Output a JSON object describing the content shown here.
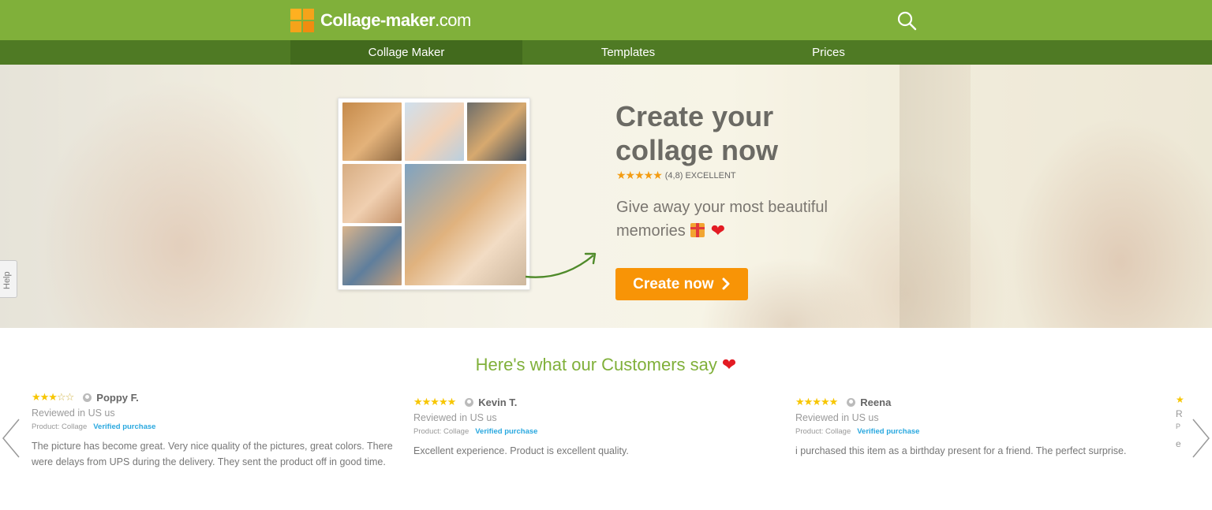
{
  "header": {
    "logo_name": "Collage-maker",
    "logo_tld": ".com",
    "search_icon": "search-icon",
    "brand_color": "#80b03a"
  },
  "nav": {
    "items": [
      {
        "label": "Collage Maker",
        "active": true
      },
      {
        "label": "Templates",
        "active": false
      },
      {
        "label": "Prices",
        "active": false
      }
    ]
  },
  "hero": {
    "title": "Create your collage now",
    "rating_stars": "★★★★★",
    "rating_text": "(4,8) EXCELLENT",
    "subtitle": "Give away your most beautiful memories",
    "cta_label": "Create now",
    "cta_icon": "chevron-right-icon",
    "cta_color": "#f89406"
  },
  "help": {
    "label": "Help"
  },
  "reviews": {
    "title": "Here's what our Customers say",
    "items": [
      {
        "stars_filled": "★★★",
        "stars_empty": "☆☆",
        "name": "Poppy F.",
        "location": "Reviewed in US us",
        "product": "Product: Collage",
        "verified": "Verified purchase",
        "text": "The picture has become great. Very nice quality of the pictures, great colors. There were delays from UPS during the delivery. They sent the product off in good time."
      },
      {
        "stars_filled": "★★★★★",
        "stars_empty": "",
        "name": "Kevin T.",
        "location": "Reviewed in US us",
        "product": "Product: Collage",
        "verified": "Verified purchase",
        "text": "Excellent experience. Product is excellent quality."
      },
      {
        "stars_filled": "★★★★★",
        "stars_empty": "",
        "name": "Reena",
        "location": "Reviewed in US us",
        "product": "Product: Collage",
        "verified": "Verified purchase",
        "text": "i purchased this item as a birthday present for a friend. The perfect surprise."
      }
    ],
    "peek": {
      "stars": "★",
      "line1": "R",
      "line2": "P",
      "line3": "e"
    }
  }
}
